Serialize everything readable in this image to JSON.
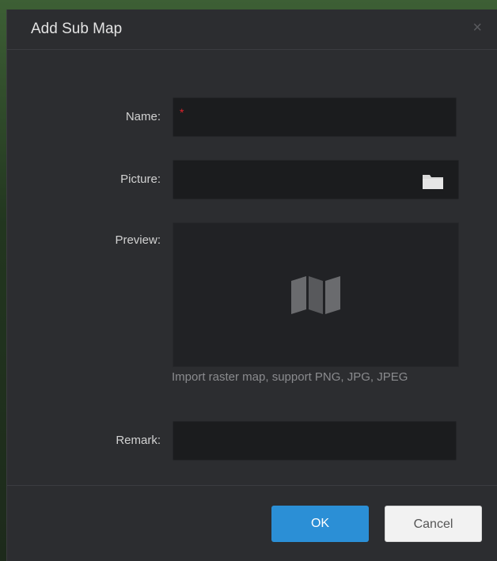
{
  "dialog": {
    "title": "Add Sub Map",
    "close_symbol": "×"
  },
  "form": {
    "name_label": "Name:",
    "name_required_mark": "*",
    "name_value": "",
    "picture_label": "Picture:",
    "picture_value": "",
    "preview_label": "Preview:",
    "preview_hint": "Import raster map, support PNG, JPG, JPEG",
    "remark_label": "Remark:",
    "remark_value": ""
  },
  "buttons": {
    "ok": "OK",
    "cancel": "Cancel"
  },
  "icons": {
    "close": "close-icon",
    "folder": "folder-icon",
    "map": "map-icon"
  },
  "colors": {
    "primary": "#2b8fd6",
    "required": "#e0222b",
    "dialog_bg": "#2c2d30"
  }
}
